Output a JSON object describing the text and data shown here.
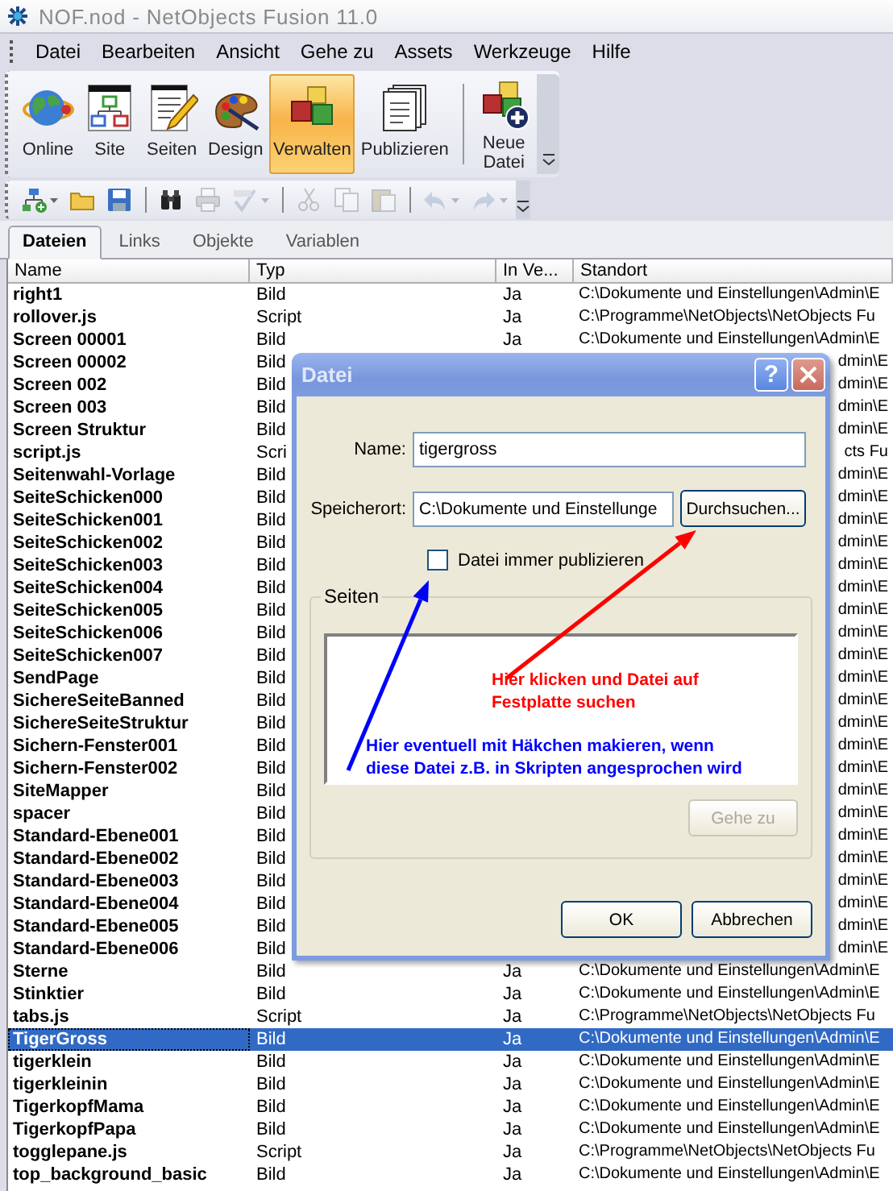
{
  "window": {
    "title": "NOF.nod - NetObjects Fusion 11.0"
  },
  "menu": [
    "Datei",
    "Bearbeiten",
    "Ansicht",
    "Gehe zu",
    "Assets",
    "Werkzeuge",
    "Hilfe"
  ],
  "views": [
    {
      "label": "Online",
      "selected": false
    },
    {
      "label": "Site",
      "selected": false
    },
    {
      "label": "Seiten",
      "selected": false
    },
    {
      "label": "Design",
      "selected": false
    },
    {
      "label": "Verwalten",
      "selected": true
    },
    {
      "label": "Publizieren",
      "selected": false
    }
  ],
  "new_file_button": "Neue Datei",
  "quick_toolbar": [
    {
      "disabled": false
    },
    {
      "disabled": false
    },
    {
      "disabled": false
    },
    {
      "disabled": false
    },
    {
      "disabled": true
    },
    {
      "disabled": true
    },
    {
      "disabled": true
    },
    {
      "disabled": true
    },
    {
      "disabled": true
    },
    {
      "disabled": true
    },
    {
      "disabled": true
    }
  ],
  "tabs": [
    {
      "label": "Dateien",
      "selected": true
    },
    {
      "label": "Links",
      "selected": false
    },
    {
      "label": "Objekte",
      "selected": false
    },
    {
      "label": "Variablen",
      "selected": false
    }
  ],
  "table": {
    "columns": [
      "Name",
      "Typ",
      "In Ve...",
      "Standort"
    ],
    "rows": [
      {
        "kind": "full",
        "name": "right1",
        "type": "Bild",
        "in_ve": "Ja",
        "standort": "C:\\Dokumente und Einstellungen\\Admin\\E",
        "selected": false
      },
      {
        "kind": "full",
        "name": "rollover.js",
        "type": "Script",
        "in_ve": "Ja",
        "standort": "C:\\Programme\\NetObjects\\NetObjects Fu",
        "selected": false
      },
      {
        "kind": "full",
        "name": "Screen 00001",
        "type": "Bild",
        "in_ve": "Ja",
        "standort": "C:\\Dokumente und Einstellungen\\Admin\\E",
        "selected": false
      },
      {
        "kind": "covered",
        "name": "Screen 00002",
        "type": "Bild",
        "standort": "dmin\\E",
        "selected": false
      },
      {
        "kind": "covered",
        "name": "Screen 002",
        "type": "Bild",
        "standort": "dmin\\E",
        "selected": false
      },
      {
        "kind": "covered",
        "name": "Screen 003",
        "type": "Bild",
        "standort": "dmin\\E",
        "selected": false
      },
      {
        "kind": "covered",
        "name": "Screen Struktur",
        "type": "Bild",
        "standort": "dmin\\E",
        "selected": false
      },
      {
        "kind": "covered",
        "name": "script.js",
        "type": "Scri",
        "standort": "cts Fu",
        "selected": false
      },
      {
        "kind": "covered",
        "name": "Seitenwahl-Vorlage",
        "type": "Bild",
        "standort": "dmin\\E",
        "selected": false
      },
      {
        "kind": "covered",
        "name": "SeiteSchicken000",
        "type": "Bild",
        "standort": "dmin\\E",
        "selected": false
      },
      {
        "kind": "covered",
        "name": "SeiteSchicken001",
        "type": "Bild",
        "standort": "dmin\\E",
        "selected": false
      },
      {
        "kind": "covered",
        "name": "SeiteSchicken002",
        "type": "Bild",
        "standort": "dmin\\E",
        "selected": false
      },
      {
        "kind": "covered",
        "name": "SeiteSchicken003",
        "type": "Bild",
        "standort": "dmin\\E",
        "selected": false
      },
      {
        "kind": "covered",
        "name": "SeiteSchicken004",
        "type": "Bild",
        "standort": "dmin\\E",
        "selected": false
      },
      {
        "kind": "covered",
        "name": "SeiteSchicken005",
        "type": "Bild",
        "standort": "dmin\\E",
        "selected": false
      },
      {
        "kind": "covered",
        "name": "SeiteSchicken006",
        "type": "Bild",
        "standort": "dmin\\E",
        "selected": false
      },
      {
        "kind": "covered",
        "name": "SeiteSchicken007",
        "type": "Bild",
        "standort": "dmin\\E",
        "selected": false
      },
      {
        "kind": "covered",
        "name": "SendPage",
        "type": "Bild",
        "standort": "dmin\\E",
        "selected": false
      },
      {
        "kind": "covered",
        "name": "SichereSeiteBanned",
        "type": "Bild",
        "standort": "dmin\\E",
        "selected": false
      },
      {
        "kind": "covered",
        "name": "SichereSeiteStruktur",
        "type": "Bild",
        "standort": "dmin\\E",
        "selected": false
      },
      {
        "kind": "covered",
        "name": "Sichern-Fenster001",
        "type": "Bild",
        "standort": "dmin\\E",
        "selected": false
      },
      {
        "kind": "covered",
        "name": "Sichern-Fenster002",
        "type": "Bild",
        "standort": "dmin\\E",
        "selected": false
      },
      {
        "kind": "covered",
        "name": "SiteMapper",
        "type": "Bild",
        "standort": "dmin\\E",
        "selected": false
      },
      {
        "kind": "covered",
        "name": "spacer",
        "type": "Bild",
        "standort": "dmin\\E",
        "selected": false
      },
      {
        "kind": "covered",
        "name": "Standard-Ebene001",
        "type": "Bild",
        "standort": "dmin\\E",
        "selected": false
      },
      {
        "kind": "covered",
        "name": "Standard-Ebene002",
        "type": "Bild",
        "standort": "dmin\\E",
        "selected": false
      },
      {
        "kind": "covered",
        "name": "Standard-Ebene003",
        "type": "Bild",
        "standort": "dmin\\E",
        "selected": false
      },
      {
        "kind": "covered",
        "name": "Standard-Ebene004",
        "type": "Bild",
        "standort": "dmin\\E",
        "selected": false
      },
      {
        "kind": "covered",
        "name": "Standard-Ebene005",
        "type": "Bild",
        "standort": "dmin\\E",
        "selected": false
      },
      {
        "kind": "covered",
        "name": "Standard-Ebene006",
        "type": "Bild",
        "standort": "dmin\\E",
        "selected": false
      },
      {
        "kind": "full",
        "name": "Sterne",
        "type": "Bild",
        "in_ve": "Ja",
        "standort": "C:\\Dokumente und Einstellungen\\Admin\\E",
        "selected": false
      },
      {
        "kind": "full",
        "name": "Stinktier",
        "type": "Bild",
        "in_ve": "Ja",
        "standort": "C:\\Dokumente und Einstellungen\\Admin\\E",
        "selected": false
      },
      {
        "kind": "full",
        "name": "tabs.js",
        "type": "Script",
        "in_ve": "Ja",
        "standort": "C:\\Programme\\NetObjects\\NetObjects Fu",
        "selected": false
      },
      {
        "kind": "full",
        "name": "TigerGross",
        "type": "Bild",
        "in_ve": "Ja",
        "standort": "C:\\Dokumente und Einstellungen\\Admin\\E",
        "selected": true
      },
      {
        "kind": "full",
        "name": "tigerklein",
        "type": "Bild",
        "in_ve": "Ja",
        "standort": "C:\\Dokumente und Einstellungen\\Admin\\E",
        "selected": false
      },
      {
        "kind": "full",
        "name": "tigerkleinin",
        "type": "Bild",
        "in_ve": "Ja",
        "standort": "C:\\Dokumente und Einstellungen\\Admin\\E",
        "selected": false
      },
      {
        "kind": "full",
        "name": "TigerkopfMama",
        "type": "Bild",
        "in_ve": "Ja",
        "standort": "C:\\Dokumente und Einstellungen\\Admin\\E",
        "selected": false
      },
      {
        "kind": "full",
        "name": "TigerkopfPapa",
        "type": "Bild",
        "in_ve": "Ja",
        "standort": "C:\\Dokumente und Einstellungen\\Admin\\E",
        "selected": false
      },
      {
        "kind": "full",
        "name": "togglepane.js",
        "type": "Script",
        "in_ve": "Ja",
        "standort": "C:\\Programme\\NetObjects\\NetObjects Fu",
        "selected": false
      },
      {
        "kind": "full",
        "name": "top_background_basic",
        "type": "Bild",
        "in_ve": "Ja",
        "standort": "C:\\Dokumente und Einstellungen\\Admin\\E",
        "selected": false
      }
    ]
  },
  "dialog": {
    "title": "Datei",
    "help_button": "?",
    "fields": [
      {
        "label": "Name:",
        "value": "tigergross"
      },
      {
        "label": "Speicherort:",
        "value": "C:\\Dokumente und Einstellunge"
      }
    ],
    "browse_button": "Durchsuchen...",
    "checkbox": {
      "label": "Datei immer publizieren",
      "checked": false
    },
    "group_title": "Seiten",
    "goto_button": {
      "label": "Gehe zu",
      "disabled": true
    },
    "buttons": [
      "OK",
      "Abbrechen"
    ]
  },
  "annotations": [
    {
      "text": "Hier klicken und Datei auf\nFestplatte suchen",
      "color": "#ff0000"
    },
    {
      "text": "Hier eventuell mit Häkchen makieren, wenn\ndiese Datei z.B. in Skripten angesprochen wird",
      "color": "#0000ff"
    }
  ]
}
